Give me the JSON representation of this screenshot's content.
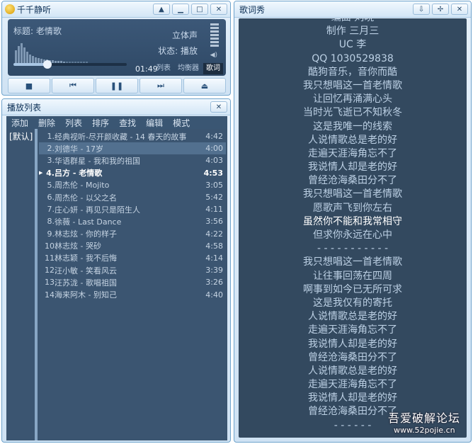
{
  "player": {
    "title": "千千静听",
    "now_playing": "标题: 老情歌",
    "sound_mode": "立体声",
    "state": "状态: 播放",
    "time": "01:49",
    "mode_buttons": [
      "列表",
      "均衡器",
      "歌词"
    ],
    "progress_fraction": 0.3
  },
  "playlist": {
    "title": "播放列表",
    "menu": [
      "添加",
      "删除",
      "列表",
      "排序",
      "查找",
      "编辑",
      "模式"
    ],
    "default_list": "[默认]",
    "tracks": [
      {
        "no": "1.",
        "name": "经典视听-尽开颜收藏 - 14 春天的故事",
        "dur": "4:42"
      },
      {
        "no": "2.",
        "name": "刘德华 - 17岁",
        "dur": "4:00"
      },
      {
        "no": "3.",
        "name": "华语群星 - 我和我的祖国",
        "dur": "4:03"
      },
      {
        "no": "4.",
        "name": "吕方 - 老情歌",
        "dur": "4:53"
      },
      {
        "no": "5.",
        "name": "周杰伦 - Mojito",
        "dur": "3:05"
      },
      {
        "no": "6.",
        "name": "周杰伦 - 以父之名",
        "dur": "5:42"
      },
      {
        "no": "7.",
        "name": "庄心妍 - 再见只是陌生人",
        "dur": "4:11"
      },
      {
        "no": "8.",
        "name": "徐薇 - Last Dance",
        "dur": "3:56"
      },
      {
        "no": "9.",
        "name": "林志炫 - 你的样子",
        "dur": "4:22"
      },
      {
        "no": "10.",
        "name": "林志炫 - 哭砂",
        "dur": "4:58"
      },
      {
        "no": "11.",
        "name": "林志颖 - 我不后悔",
        "dur": "4:14"
      },
      {
        "no": "12.",
        "name": "汪小敏 - 笑看风云",
        "dur": "3:39"
      },
      {
        "no": "13.",
        "name": "汪苏泷 - 歌唱祖国",
        "dur": "3:26"
      },
      {
        "no": "14.",
        "name": "海来阿木 - 别知己",
        "dur": "4:40"
      }
    ]
  },
  "lyrics": {
    "title": "歌词秀",
    "lines": [
      "编曲 刘晓",
      "制作 三月三",
      "UC 李",
      "QQ 1030529838",
      "酷狗音乐，音你而酷",
      "我只想唱这一首老情歌",
      "让回忆再涌满心头",
      "当时光飞逝已不知秋冬",
      "这是我唯一的线索",
      "人说情歌总是老的好",
      "走遍天涯海角忘不了",
      "我说情人却是老的好",
      "曾经沧海桑田分不了",
      "我只想唱这一首老情歌",
      "愿歌声飞到你左右",
      "虽然你不能和我常相守",
      "但求你永远在心中",
      "- - - - - - - - - - -",
      "我只想唱这一首老情歌",
      "让往事回荡在四周",
      "啊事到如今已无所可求",
      "这是我仅有的寄托",
      "人说情歌总是老的好",
      "走遍天涯海角忘不了",
      "我说情人却是老的好",
      "曾经沧海桑田分不了",
      "人说情歌总是老的好",
      "走遍天涯海角忘不了",
      "我说情人却是老的好",
      "曾经沧海桑田分不了",
      "- - - - - -"
    ]
  },
  "watermark": {
    "name": "吾爱破解论坛",
    "url": "www.52pojie.cn"
  }
}
